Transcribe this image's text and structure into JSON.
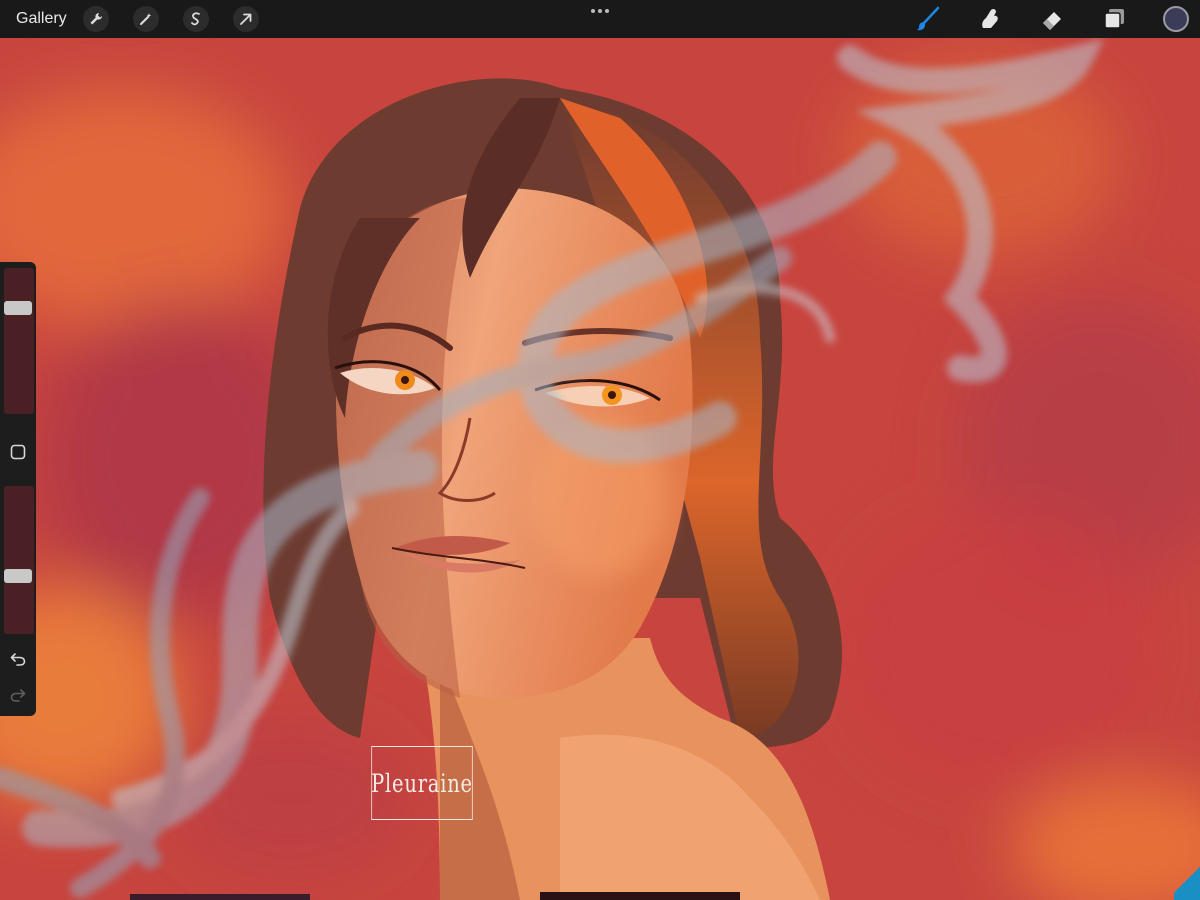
{
  "toolbar": {
    "gallery_label": "Gallery",
    "left_tools": [
      "wrench-icon",
      "magic-wand-icon",
      "selection-icon",
      "transform-arrow-icon"
    ],
    "more_icon": "more-dots-icon",
    "right_tools": [
      "brush-icon",
      "smudge-icon",
      "eraser-icon",
      "layers-icon"
    ],
    "current_color": "#3b3d58",
    "active_tool_color": "#1e88e5"
  },
  "sidebar": {
    "brush_size_level": 0.75,
    "opacity_level": 0.38,
    "modify_icon": "square-icon",
    "undo_icon": "undo-icon",
    "redo_icon": "redo-icon"
  },
  "canvas": {
    "signature_text": "Pleuraine"
  }
}
